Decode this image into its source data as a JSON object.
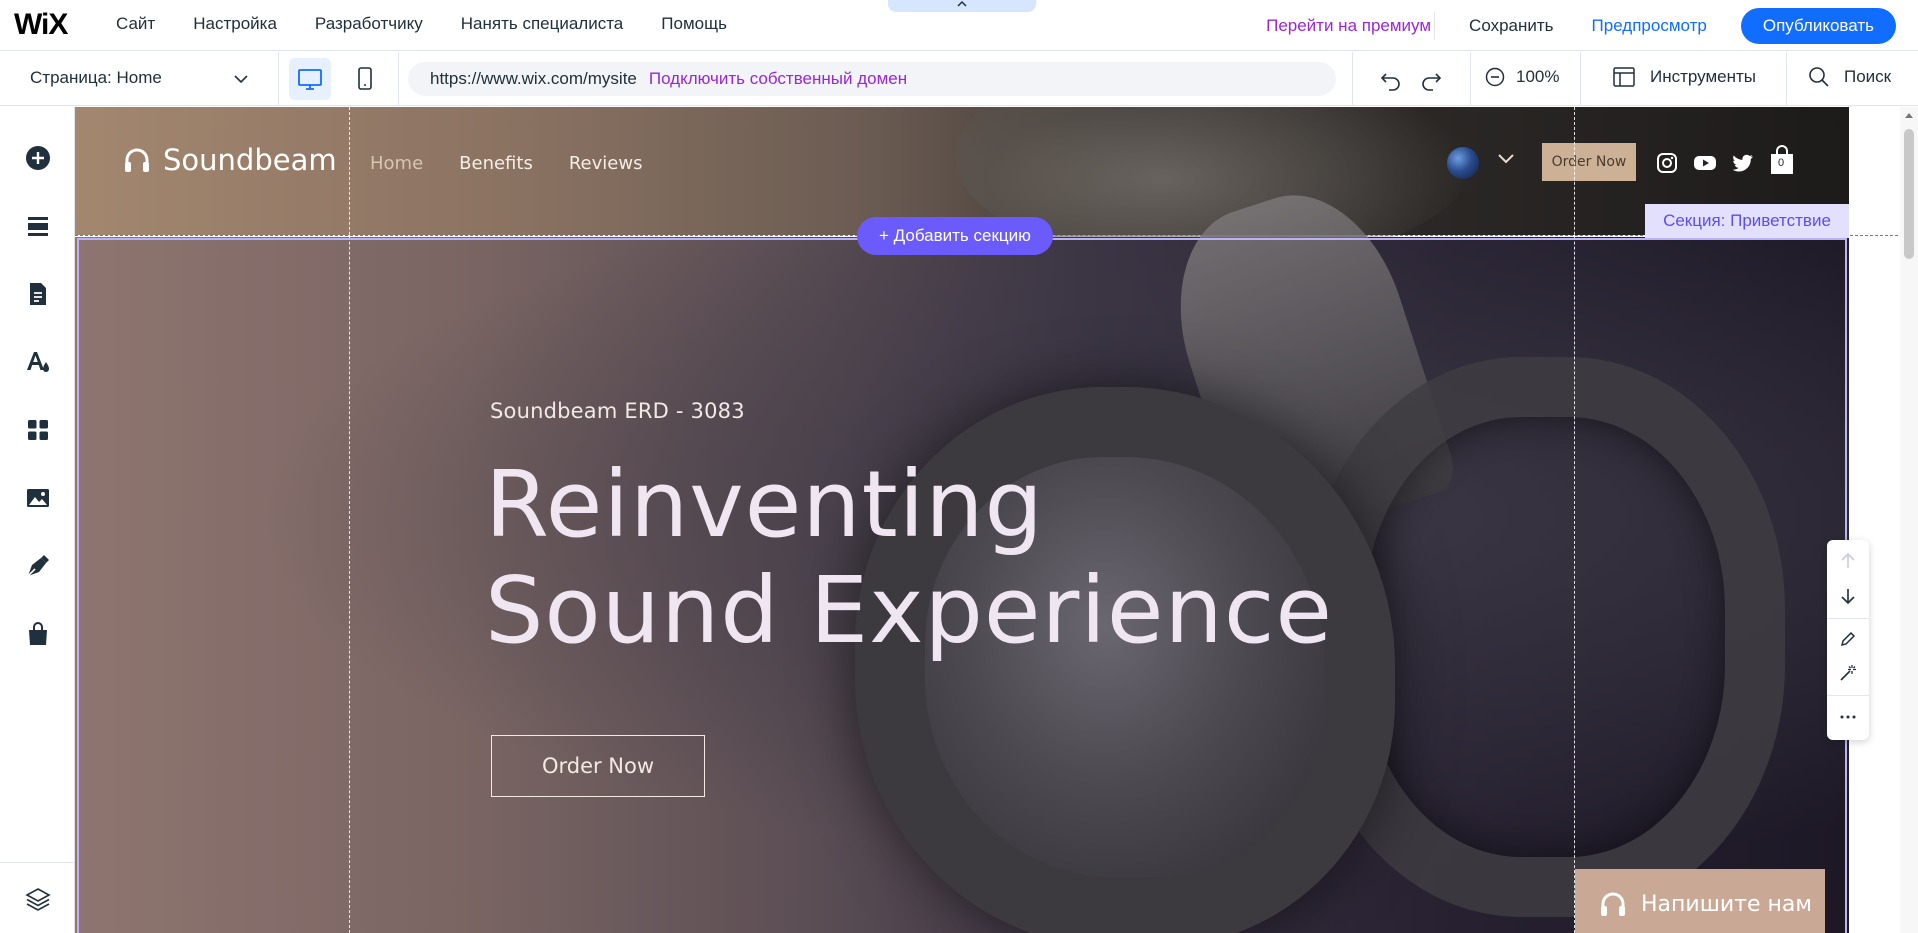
{
  "topbar": {
    "logo": "WiX",
    "menu": [
      "Сайт",
      "Настройка",
      "Разработчику",
      "Нанять специалиста",
      "Помощь"
    ],
    "collapse_icon": "chevron-up",
    "premium": "Перейти на премиум",
    "save": "Сохранить",
    "preview": "Предпросмотр",
    "publish": "Опубликовать"
  },
  "toolbar": {
    "page_label": "Страница:",
    "page_value": "Home",
    "url": "https://www.wix.com/mysite",
    "connect_domain": "Подключить собственный домен",
    "zoom": "100%",
    "tools": "Инструменты",
    "search": "Поиск"
  },
  "left_rail": [
    "add-icon",
    "sections-icon",
    "pages-icon",
    "design-icon",
    "apps-icon",
    "media-icon",
    "pen-icon",
    "store-icon",
    "layers-icon"
  ],
  "site": {
    "brand": "Soundbeam",
    "nav": [
      "Home",
      "Benefits",
      "Reviews"
    ],
    "header_order": "Order Now",
    "cart_count": "0",
    "subtitle": "Soundbeam ERD - 3083",
    "headline_1": "Reinventing",
    "headline_2": "Sound Experience",
    "hero_order": "Order Now",
    "chat": "Напишите нам"
  },
  "editor": {
    "add_section": "Добавить секцию",
    "section_tag": "Секция: Приветствие"
  },
  "colors": {
    "accent_blue": "#116dff",
    "premium_purple": "#9a27d5",
    "section_purple": "#6b5bfa"
  }
}
